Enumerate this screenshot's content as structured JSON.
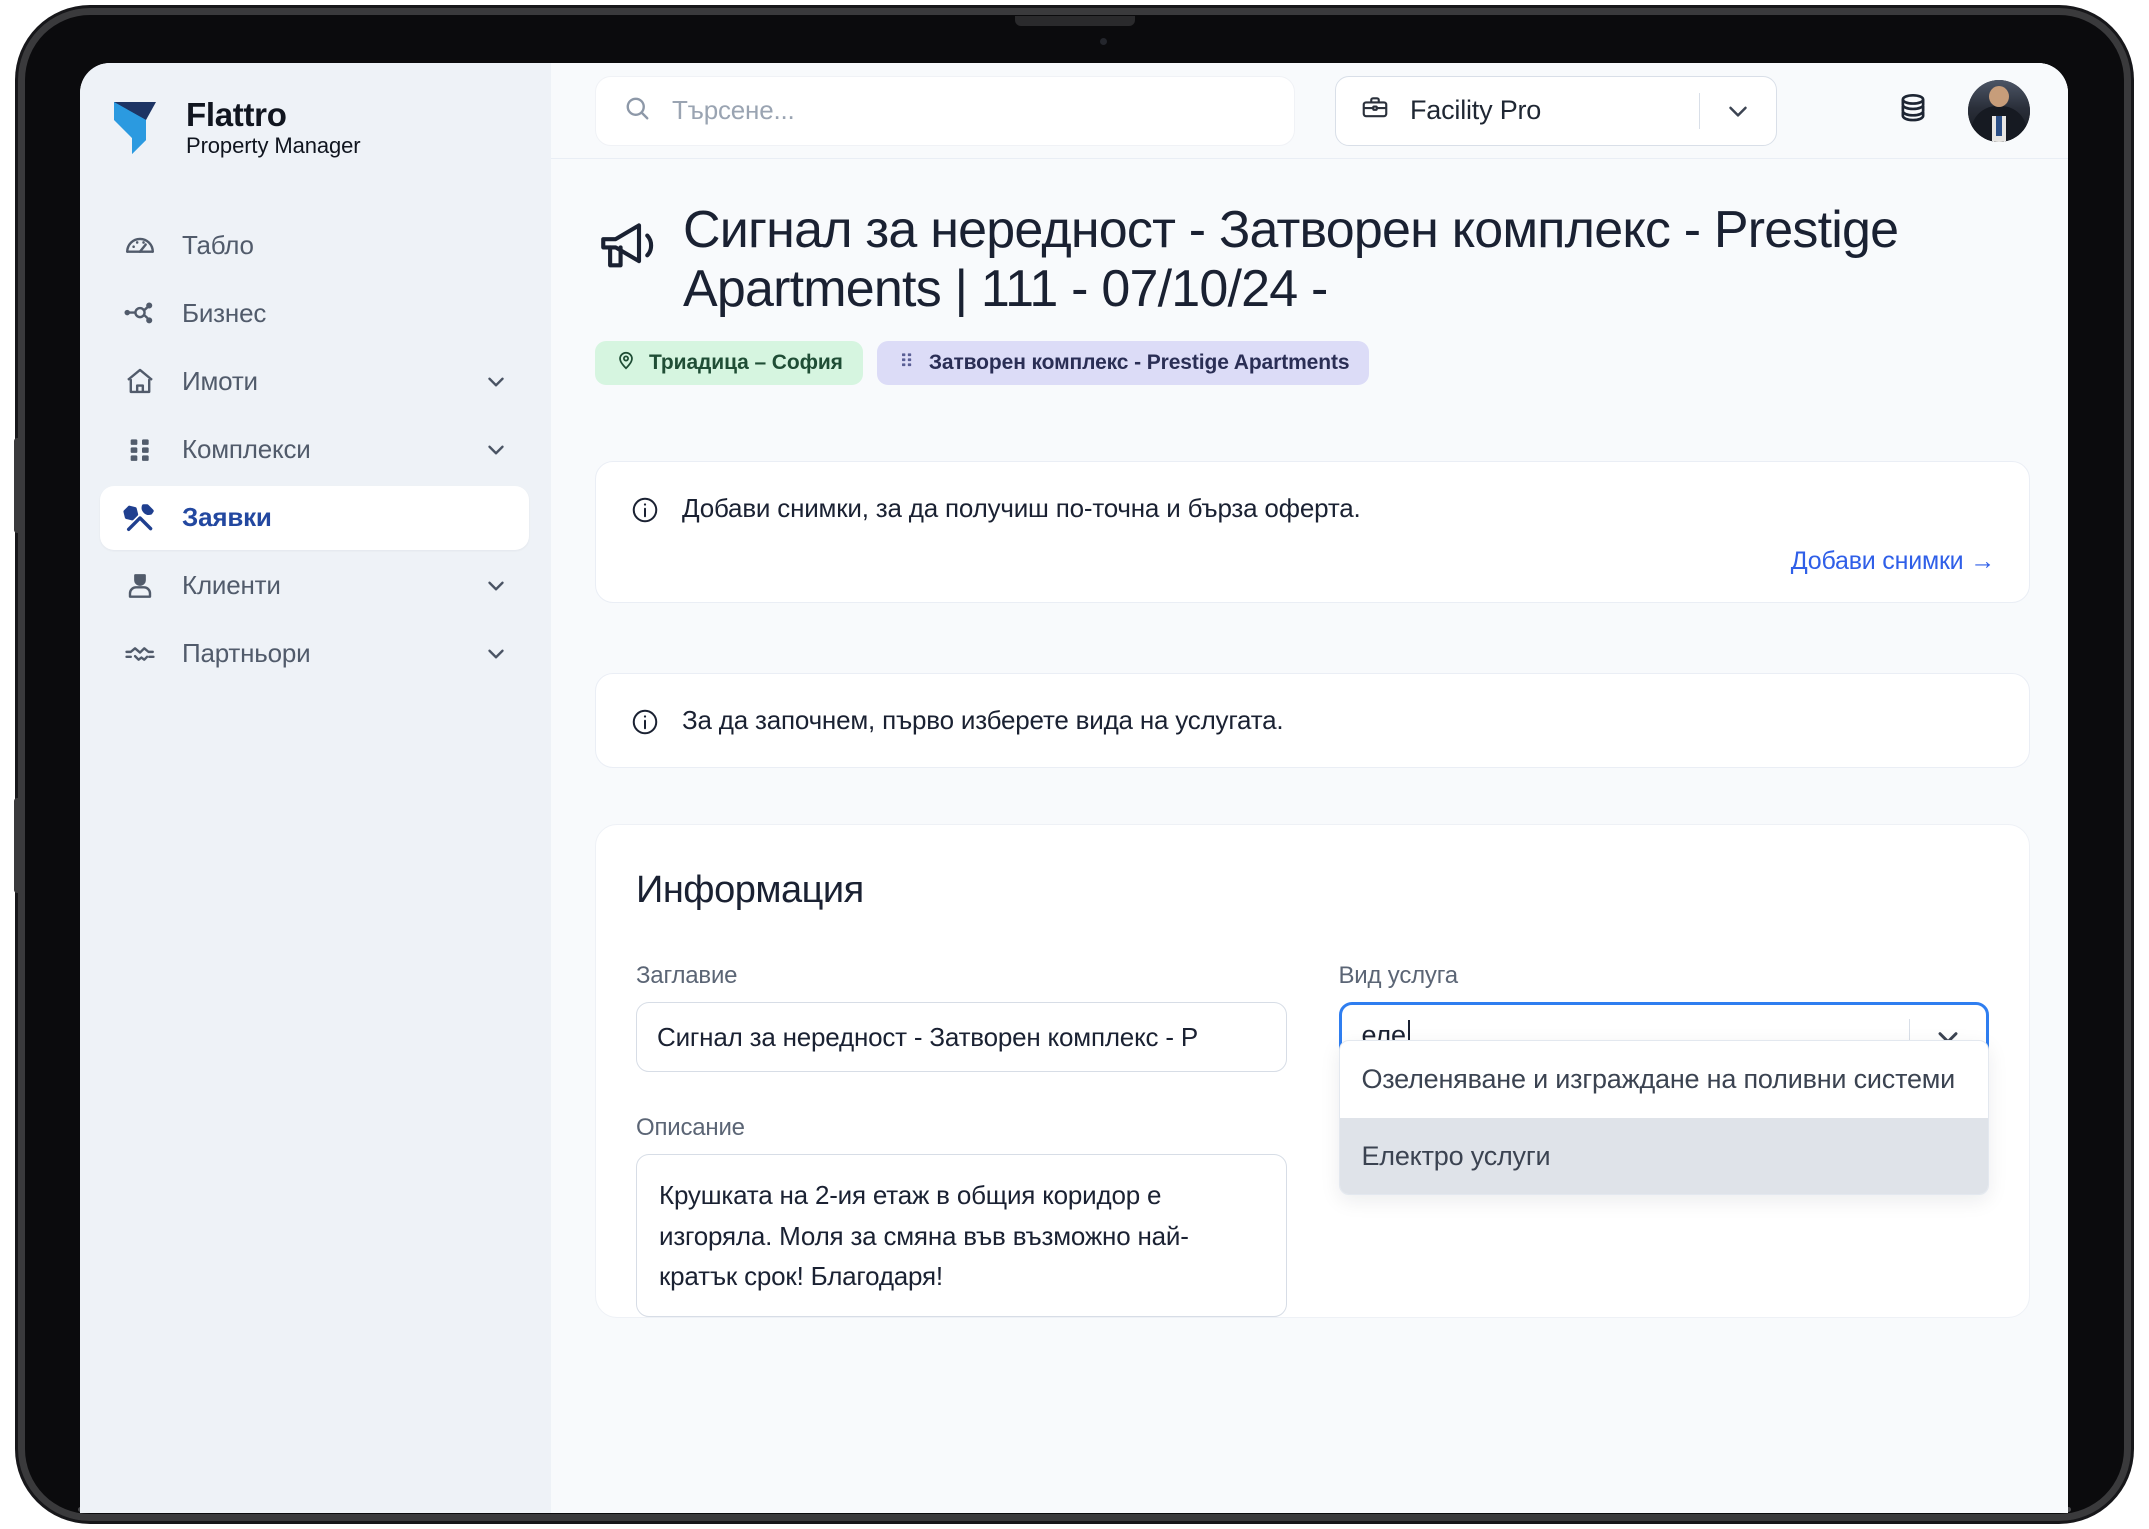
{
  "brand": {
    "name": "Flattro",
    "subtitle": "Property Manager",
    "logo_icon": "flattro-logo-icon"
  },
  "sidebar": {
    "items": [
      {
        "label": "Табло",
        "icon": "dashboard-gauge-icon",
        "chevron": false,
        "active": false
      },
      {
        "label": "Бизнес",
        "icon": "business-network-icon",
        "chevron": false,
        "active": false
      },
      {
        "label": "Имоти",
        "icon": "home-icon",
        "chevron": true,
        "active": false
      },
      {
        "label": "Комплекси",
        "icon": "grid-dots-icon",
        "chevron": true,
        "active": false
      },
      {
        "label": "Заявки",
        "icon": "tools-wrench-screwdriver-icon",
        "chevron": false,
        "active": true
      },
      {
        "label": "Клиенти",
        "icon": "user-person-icon",
        "chevron": true,
        "active": false
      },
      {
        "label": "Партньори",
        "icon": "handshake-icon",
        "chevron": true,
        "active": false
      }
    ]
  },
  "topbar": {
    "search": {
      "placeholder": "Търсене...",
      "value": "",
      "icon": "search-icon"
    },
    "workspace": {
      "label": "Facility Pro",
      "icon": "briefcase-icon",
      "chevron_icon": "chevron-down-icon"
    },
    "coins_icon": "coins-stack-icon",
    "avatar_icon": "user-avatar"
  },
  "page": {
    "title_icon": "megaphone-icon",
    "title": "Сигнал за нередност - Затворен комплекс - Prestige Apartments | 111 - 07/10/24 -",
    "badges": [
      {
        "label": "Триадица – София",
        "icon": "map-pin-icon",
        "color": "#d6f5e0",
        "text_color": "#1f4d35"
      },
      {
        "label": "Затворен комплекс - Prestige Apartments",
        "icon": "grid-dots-icon",
        "color": "#dcdcf7",
        "text_color": "#2a2e55"
      }
    ]
  },
  "alerts": {
    "photos": {
      "icon": "info-circle-icon",
      "text": "Добави снимки, за да получиш по-точна и бърза оферта.",
      "link_label": "Добави снимки →"
    },
    "service": {
      "icon": "info-circle-icon",
      "text": "За да започнем, първо изберете вида на услугата."
    }
  },
  "info_section": {
    "heading": "Информация",
    "title_field": {
      "label": "Заглавие",
      "value": "Сигнал за нередност - Затворен комплекс - P"
    },
    "service_field": {
      "label": "Вид услуга",
      "value": "еле",
      "chevron_icon": "chevron-down-icon",
      "options": [
        {
          "label": "Озеленяване и изграждане на поливни системи",
          "highlighted": false
        },
        {
          "label": "Електро услуги",
          "highlighted": true
        }
      ]
    },
    "description_field": {
      "label": "Описание",
      "value": "Крушката на 2-ия етаж в общия коридор е изгоряла. Моля за смяна във възможно най-кратък срок! Благодаря!"
    }
  },
  "colors": {
    "accent": "#2f5fe8",
    "focus_border": "#2f7ef0",
    "sidebar_bg": "#eef2f7",
    "page_bg": "#f8fafc",
    "active_nav_text": "#2348a0"
  }
}
